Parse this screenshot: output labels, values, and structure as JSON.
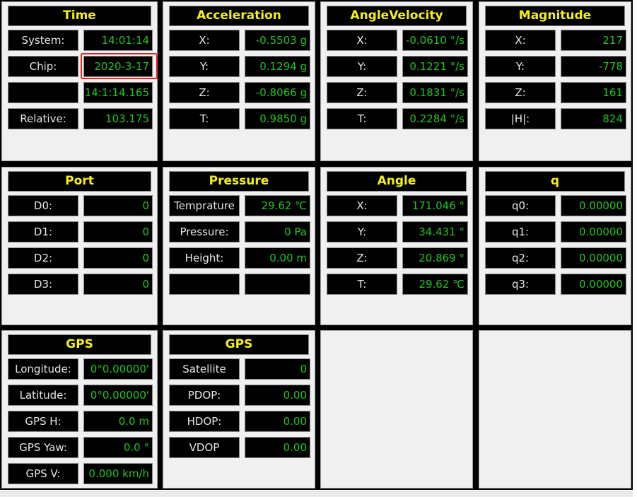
{
  "panels": {
    "time": {
      "title": "Time",
      "rows": [
        {
          "label": "System:",
          "value": "14:01:14"
        },
        {
          "label": "Chip:",
          "value": "2020-3-17"
        },
        {
          "label": "",
          "value": "14:1:14.165"
        },
        {
          "label": "Relative:",
          "value": "103.175"
        }
      ]
    },
    "acceleration": {
      "title": "Acceleration",
      "rows": [
        {
          "label": "X:",
          "value": "-0.5503 g"
        },
        {
          "label": "Y:",
          "value": "0.1294 g"
        },
        {
          "label": "Z:",
          "value": "-0.8066 g"
        },
        {
          "label": "T:",
          "value": "0.9850 g"
        }
      ]
    },
    "angle_velocity": {
      "title": "AngleVelocity",
      "rows": [
        {
          "label": "X:",
          "value": "-0.0610 °/s"
        },
        {
          "label": "Y:",
          "value": "0.1221 °/s"
        },
        {
          "label": "Z:",
          "value": "0.1831 °/s"
        },
        {
          "label": "T:",
          "value": "0.2284 °/s"
        }
      ]
    },
    "magnitude": {
      "title": "Magnitude",
      "rows": [
        {
          "label": "X:",
          "value": "217"
        },
        {
          "label": "Y:",
          "value": "-778"
        },
        {
          "label": "Z:",
          "value": "161"
        },
        {
          "label": "|H|:",
          "value": "824"
        }
      ]
    },
    "port": {
      "title": "Port",
      "rows": [
        {
          "label": "D0:",
          "value": "0"
        },
        {
          "label": "D1:",
          "value": "0"
        },
        {
          "label": "D2:",
          "value": "0"
        },
        {
          "label": "D3:",
          "value": "0"
        }
      ]
    },
    "pressure": {
      "title": "Pressure",
      "rows": [
        {
          "label": "Temprature",
          "value": "29.62 ℃"
        },
        {
          "label": "Pressure:",
          "value": "0 Pa"
        },
        {
          "label": "Height:",
          "value": "0.00 m"
        },
        {
          "label": "",
          "value": ""
        }
      ]
    },
    "angle": {
      "title": "Angle",
      "rows": [
        {
          "label": "X:",
          "value": "171.046 °"
        },
        {
          "label": "Y:",
          "value": "34.431 °"
        },
        {
          "label": "Z:",
          "value": "20.869 °"
        },
        {
          "label": "T:",
          "value": "29.62 ℃"
        }
      ]
    },
    "quaternion": {
      "title": "q",
      "rows": [
        {
          "label": "q0:",
          "value": "0.00000"
        },
        {
          "label": "q1:",
          "value": "0.00000"
        },
        {
          "label": "q2:",
          "value": "0.00000"
        },
        {
          "label": "q3:",
          "value": "0.00000"
        }
      ]
    },
    "gps_position": {
      "title": "GPS",
      "rows": [
        {
          "label": "Longitude:",
          "value": "0°0.00000'"
        },
        {
          "label": "Latitude:",
          "value": "0°0.00000'"
        },
        {
          "label": "GPS H:",
          "value": "0.0 m"
        },
        {
          "label": "GPS Yaw:",
          "value": "0.0 °"
        },
        {
          "label": "GPS V:",
          "value": "0.000 km/h"
        }
      ]
    },
    "gps_accuracy": {
      "title": "GPS",
      "rows": [
        {
          "label": "Satellite",
          "value": "0"
        },
        {
          "label": "PDOP:",
          "value": "0.00"
        },
        {
          "label": "HDOP:",
          "value": "0.00"
        },
        {
          "label": "VDOP",
          "value": "0.00"
        }
      ]
    }
  },
  "colors": {
    "title_text": "#f5ef1a",
    "value_text": "#22c422",
    "label_text": "#e6e6e6",
    "highlight": "#e8231f"
  }
}
